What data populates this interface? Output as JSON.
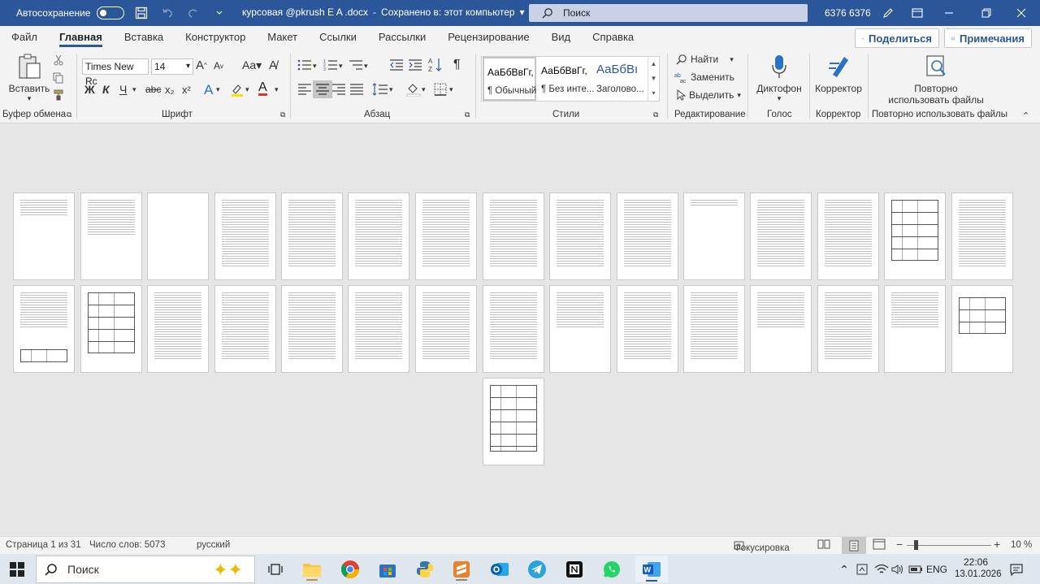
{
  "titlebar": {
    "autosave_label": "Автосохранение",
    "doc_name": "курсовая @pkrush E A .docx",
    "saved_status": "Сохранено в: этот компьютер",
    "search_placeholder": "Поиск",
    "user": "6376 6376"
  },
  "menu": {
    "tabs": [
      "Файл",
      "Главная",
      "Вставка",
      "Конструктор",
      "Макет",
      "Ссылки",
      "Рассылки",
      "Рецензирование",
      "Вид",
      "Справка"
    ],
    "active_tab": "Главная",
    "share": "Поделиться",
    "comments": "Примечания"
  },
  "ribbon": {
    "paste": "Вставить",
    "font_name": "Times New Rc",
    "font_size": "14",
    "bold": "Ж",
    "italic": "К",
    "underline": "Ч",
    "strike": "abc",
    "subscript": "x₂",
    "superscript": "x²",
    "grow_font": "A",
    "shrink_font": "A",
    "text_effects": "A",
    "font_color": "A",
    "paragraph_mark": "¶",
    "styles": [
      {
        "sample": "АаБбВвГг,",
        "name": "¶ Обычный"
      },
      {
        "sample": "АаБбВвГг,",
        "name": "¶ Без инте..."
      },
      {
        "sample": "АаБбВı",
        "name": "Заголово..."
      }
    ],
    "find": "Найти",
    "replace": "Заменить",
    "select": "Выделить",
    "dictate": "Диктофон",
    "editor": "Корректор",
    "reuse_line1": "Повторно",
    "reuse_line2": "использовать файлы",
    "groups": [
      "Буфер обмена",
      "Шрифт",
      "Абзац",
      "Стили",
      "Редактирование",
      "Голос",
      "Корректор",
      "Повторно использовать файлы"
    ]
  },
  "statusbar": {
    "page": "Страница 1 из 31",
    "words": "Число слов: 5073",
    "language": "русский",
    "focus": "Фокусировка",
    "zoom": "10 %"
  },
  "taskbar": {
    "search": "Поиск",
    "lang": "ENG",
    "time": "22:06",
    "date": "13.01.2026"
  },
  "colors": {
    "titlebar": "#2b579a",
    "accent": "#2b579a"
  }
}
